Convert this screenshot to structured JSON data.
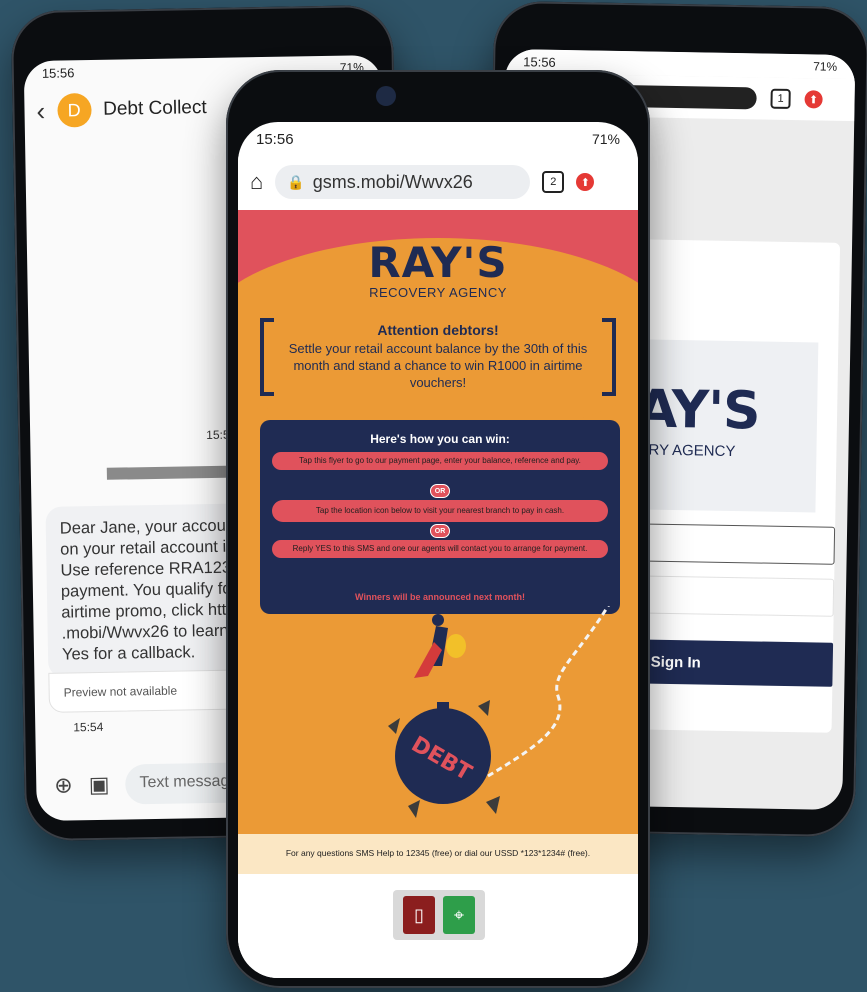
{
  "left_phone": {
    "status_time": "15:56",
    "status_right": "71%",
    "contact_name": "Debt Collect",
    "avatar_letter": "D",
    "earlier_time": "15:54",
    "message_lines": [
      "Dear Jane, your accour",
      "on your retail account is",
      "Use reference RRA123 v",
      "payment. You qualify fo",
      "airtime promo, click http",
      ".mobi/Wwvx26 to learn",
      "Yes for a callback."
    ],
    "preview_note": "Preview not available",
    "message_time": "15:54",
    "compose_placeholder": "Text messag"
  },
  "right_phone": {
    "status_time": "15:56",
    "status_right": "71%",
    "tab_count": "1",
    "logo_big": "AY'S",
    "logo_small": "ERY AGENCY",
    "signin_label": "Sign In"
  },
  "center_phone": {
    "status_time": "15:56",
    "status_right": "71%",
    "url": "gsms.mobi/Wwvx26",
    "tab_count": "2",
    "flyer": {
      "brand": "RAY'S",
      "brand_sub": "RECOVERY AGENCY",
      "attention_title": "Attention debtors!",
      "attention_body": "Settle your retail account balance by the 30th of this month and stand a chance to win R1000 in airtime vouchers!",
      "howto_title": "Here's how you can win:",
      "step1": "Tap this flyer to go to our payment page, enter your balance, reference and pay.",
      "step2": "Tap the location icon below to visit your nearest branch to pay in cash.",
      "step3": "Reply YES to this SMS and one our agents will contact you to arrange for payment.",
      "or_label": "OR",
      "winners": "Winners will be announced next month!",
      "ball_label": "DEBT"
    },
    "footer": "For any questions SMS Help to 12345 (free) or dial our USSD *123*1234# (free)."
  }
}
